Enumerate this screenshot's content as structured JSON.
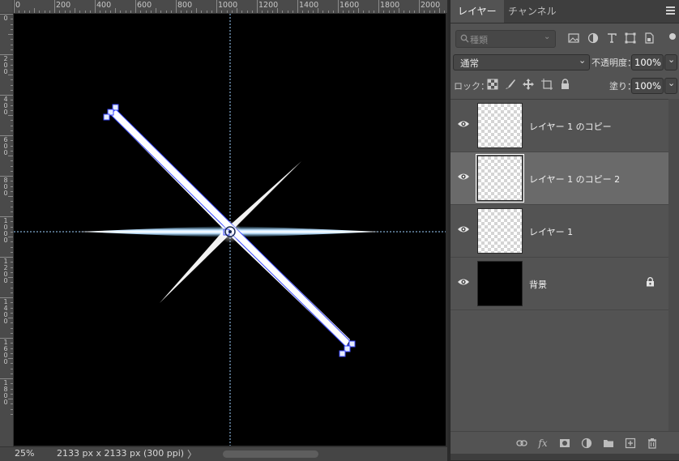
{
  "ruler": {
    "top_labels": [
      "0",
      "200",
      "400",
      "600",
      "800",
      "1000",
      "1200",
      "1400",
      "1600",
      "1800",
      "2000"
    ],
    "left_labels": [
      "0",
      "200",
      "400",
      "600",
      "800",
      "1000",
      "1200",
      "1400",
      "1600",
      "1800"
    ]
  },
  "status": {
    "zoom": "25%",
    "doc_info": "2133 px x 2133 px (300 ppi)",
    "arrow": "〉"
  },
  "panel": {
    "tabs": [
      {
        "label": "レイヤー",
        "active": true
      },
      {
        "label": "チャンネル",
        "active": false
      }
    ],
    "filter": {
      "label": "種類",
      "icons": [
        "image-filter-icon",
        "adjustment-filter-icon",
        "type-filter-icon",
        "shape-filter-icon",
        "smart-object-filter-icon"
      ]
    },
    "blend_mode": "通常",
    "opacity_label": "不透明度：",
    "opacity_value": "100%",
    "lock_label": "ロック：",
    "fill_label": "塗り：",
    "fill_value": "100%",
    "layers": [
      {
        "name": "レイヤー 1 のコピー",
        "visible": true,
        "selected": false,
        "thumb": "transparent",
        "locked": false
      },
      {
        "name": "レイヤー 1 のコピー 2",
        "visible": true,
        "selected": true,
        "thumb": "transparent",
        "locked": false
      },
      {
        "name": "レイヤー 1",
        "visible": true,
        "selected": false,
        "thumb": "transparent",
        "locked": false
      },
      {
        "name": "背景",
        "visible": true,
        "selected": false,
        "thumb": "black",
        "locked": true
      }
    ],
    "footer_icons": [
      "link-layers-icon",
      "fx-icon",
      "add-mask-icon",
      "adjustment-layer-icon",
      "new-group-icon",
      "new-layer-icon",
      "delete-layer-icon"
    ],
    "footer_fx": "fx"
  },
  "colors": {
    "panel_bg": "#535353",
    "selected_row": "#6a6a6a",
    "canvas_bg": "#000000",
    "guide": "#6fb6ff",
    "path": "#3a48ff"
  }
}
